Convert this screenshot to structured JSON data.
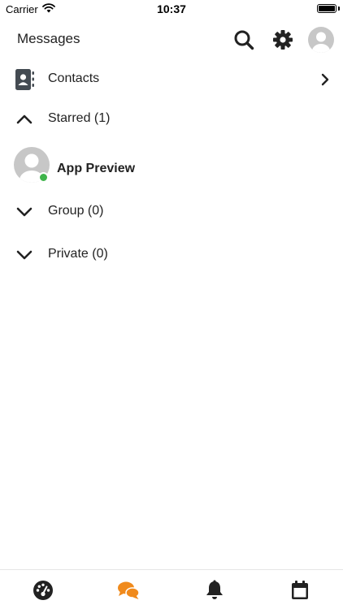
{
  "status_bar": {
    "carrier": "Carrier",
    "time": "10:37"
  },
  "header": {
    "title": "Messages"
  },
  "rows": {
    "contacts": "Contacts",
    "starred": "Starred (1)",
    "group": "Group (0)",
    "private": "Private (0)"
  },
  "starred_items": [
    {
      "name": "App Preview",
      "status": "online"
    }
  ],
  "tab_bar": {
    "active": "messages"
  },
  "colors": {
    "accent": "#f08a1c",
    "online": "#3fb44b",
    "icon": "#222222",
    "avatar_gray": "#c7c7c7"
  }
}
